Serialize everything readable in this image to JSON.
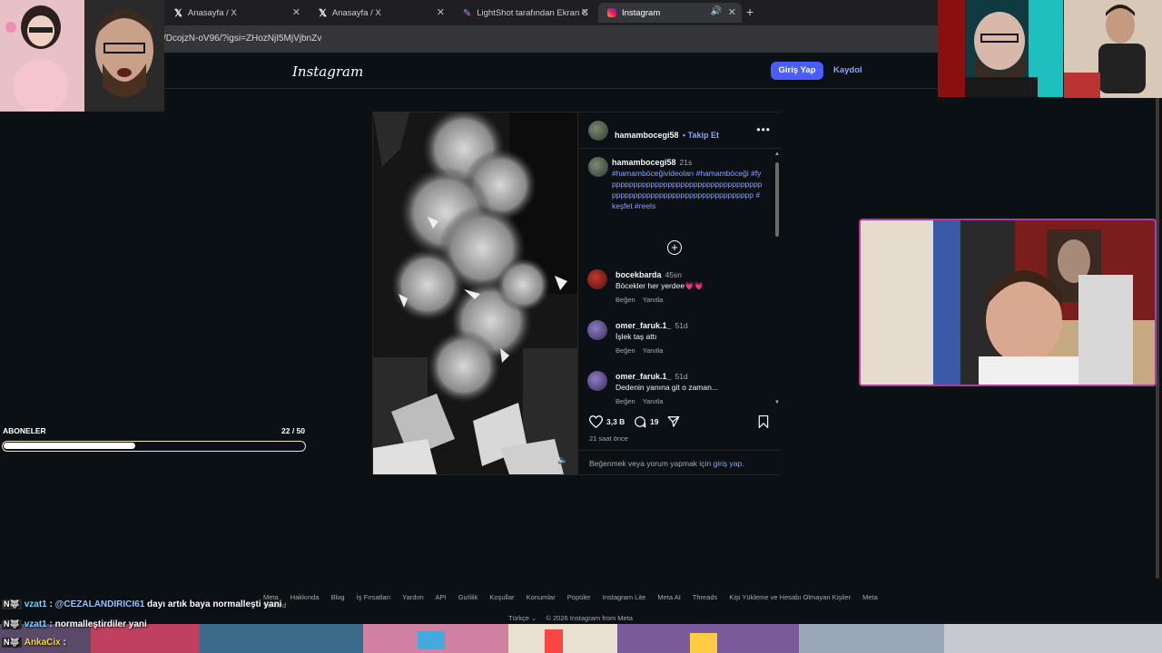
{
  "browser": {
    "tabs": [
      {
        "title": "Anasayfa / X",
        "icon": "x-logo-icon"
      },
      {
        "title": "Anasayfa / X",
        "icon": "x-logo-icon"
      },
      {
        "title": "LightShot tarafından Ekran Görü",
        "icon": "feather-icon"
      },
      {
        "title": "Instagram",
        "icon": "instagram-icon",
        "active": true
      }
    ],
    "url": "/DcojzN-oV96/?igsi=ZHozNjI5MjVjbnZv"
  },
  "header": {
    "logo": "Instagram",
    "login": "Giriş Yap",
    "signup": "Kaydol"
  },
  "post": {
    "username": "hamambocegi58",
    "follow": "• Takip Et",
    "caption": {
      "user": "hamambocegi58",
      "time": "21s",
      "text": "#hamamböceğivideoları #hamamböceği #fypppppppppppppppppppppppppppppppppppppppppppppppppppppppppppppppppppp #keşfet #reels"
    },
    "comments": [
      {
        "user": "bocekbarda",
        "time": "45sn",
        "text": "Böcekler her yerdee💗💗",
        "like": "Beğen",
        "reply": "Yanıtla"
      },
      {
        "user": "omer_faruk.1_",
        "time": "51d",
        "text": "İşlek taş attı",
        "like": "Beğen",
        "reply": "Yanıtla"
      },
      {
        "user": "omer_faruk.1_",
        "time": "51d",
        "text": "Dedenin yanına git o zaman...",
        "like": "Beğen",
        "reply": "Yanıtla"
      }
    ],
    "likes": "3,3 B",
    "comment_count": "19",
    "posted": "21 saat önce",
    "login_prompt": {
      "text": "Beğenmek veya yorum yapmak için ",
      "link": "giriş yap",
      "end": "."
    }
  },
  "footer": {
    "links": [
      "Meta",
      "Hakkında",
      "Blog",
      "İş Fırsatları",
      "Yardım",
      "API",
      "Gizlilik",
      "Koşullar",
      "Konumlar",
      "Popüler",
      "Instagram Lite",
      "Meta AI",
      "Threads",
      "Kişi Yükleme ve Hesabı Olmayan Kişiler",
      "Meta Verified"
    ],
    "language": "Türkçe",
    "copyright": "© 2026 Instagram from Meta"
  },
  "overlay": {
    "subs_label": "ABONELER",
    "subs_count": "22 / 50",
    "subs_progress": 0.44,
    "chat": [
      {
        "badge": "N🐺",
        "user": "vzat1",
        "sep": " : ",
        "mention": "@CEZALANDIRICI61",
        "text": " dayı artık baya normalleşti yani"
      },
      {
        "badge": "N🐺",
        "user": "vzat1",
        "sep": " : ",
        "mention": "",
        "text": "normalleştirdiler yani"
      },
      {
        "badge": "N🐺",
        "user": "AnkaCix",
        "sep": " : ",
        "mention": "",
        "text": ""
      }
    ]
  }
}
